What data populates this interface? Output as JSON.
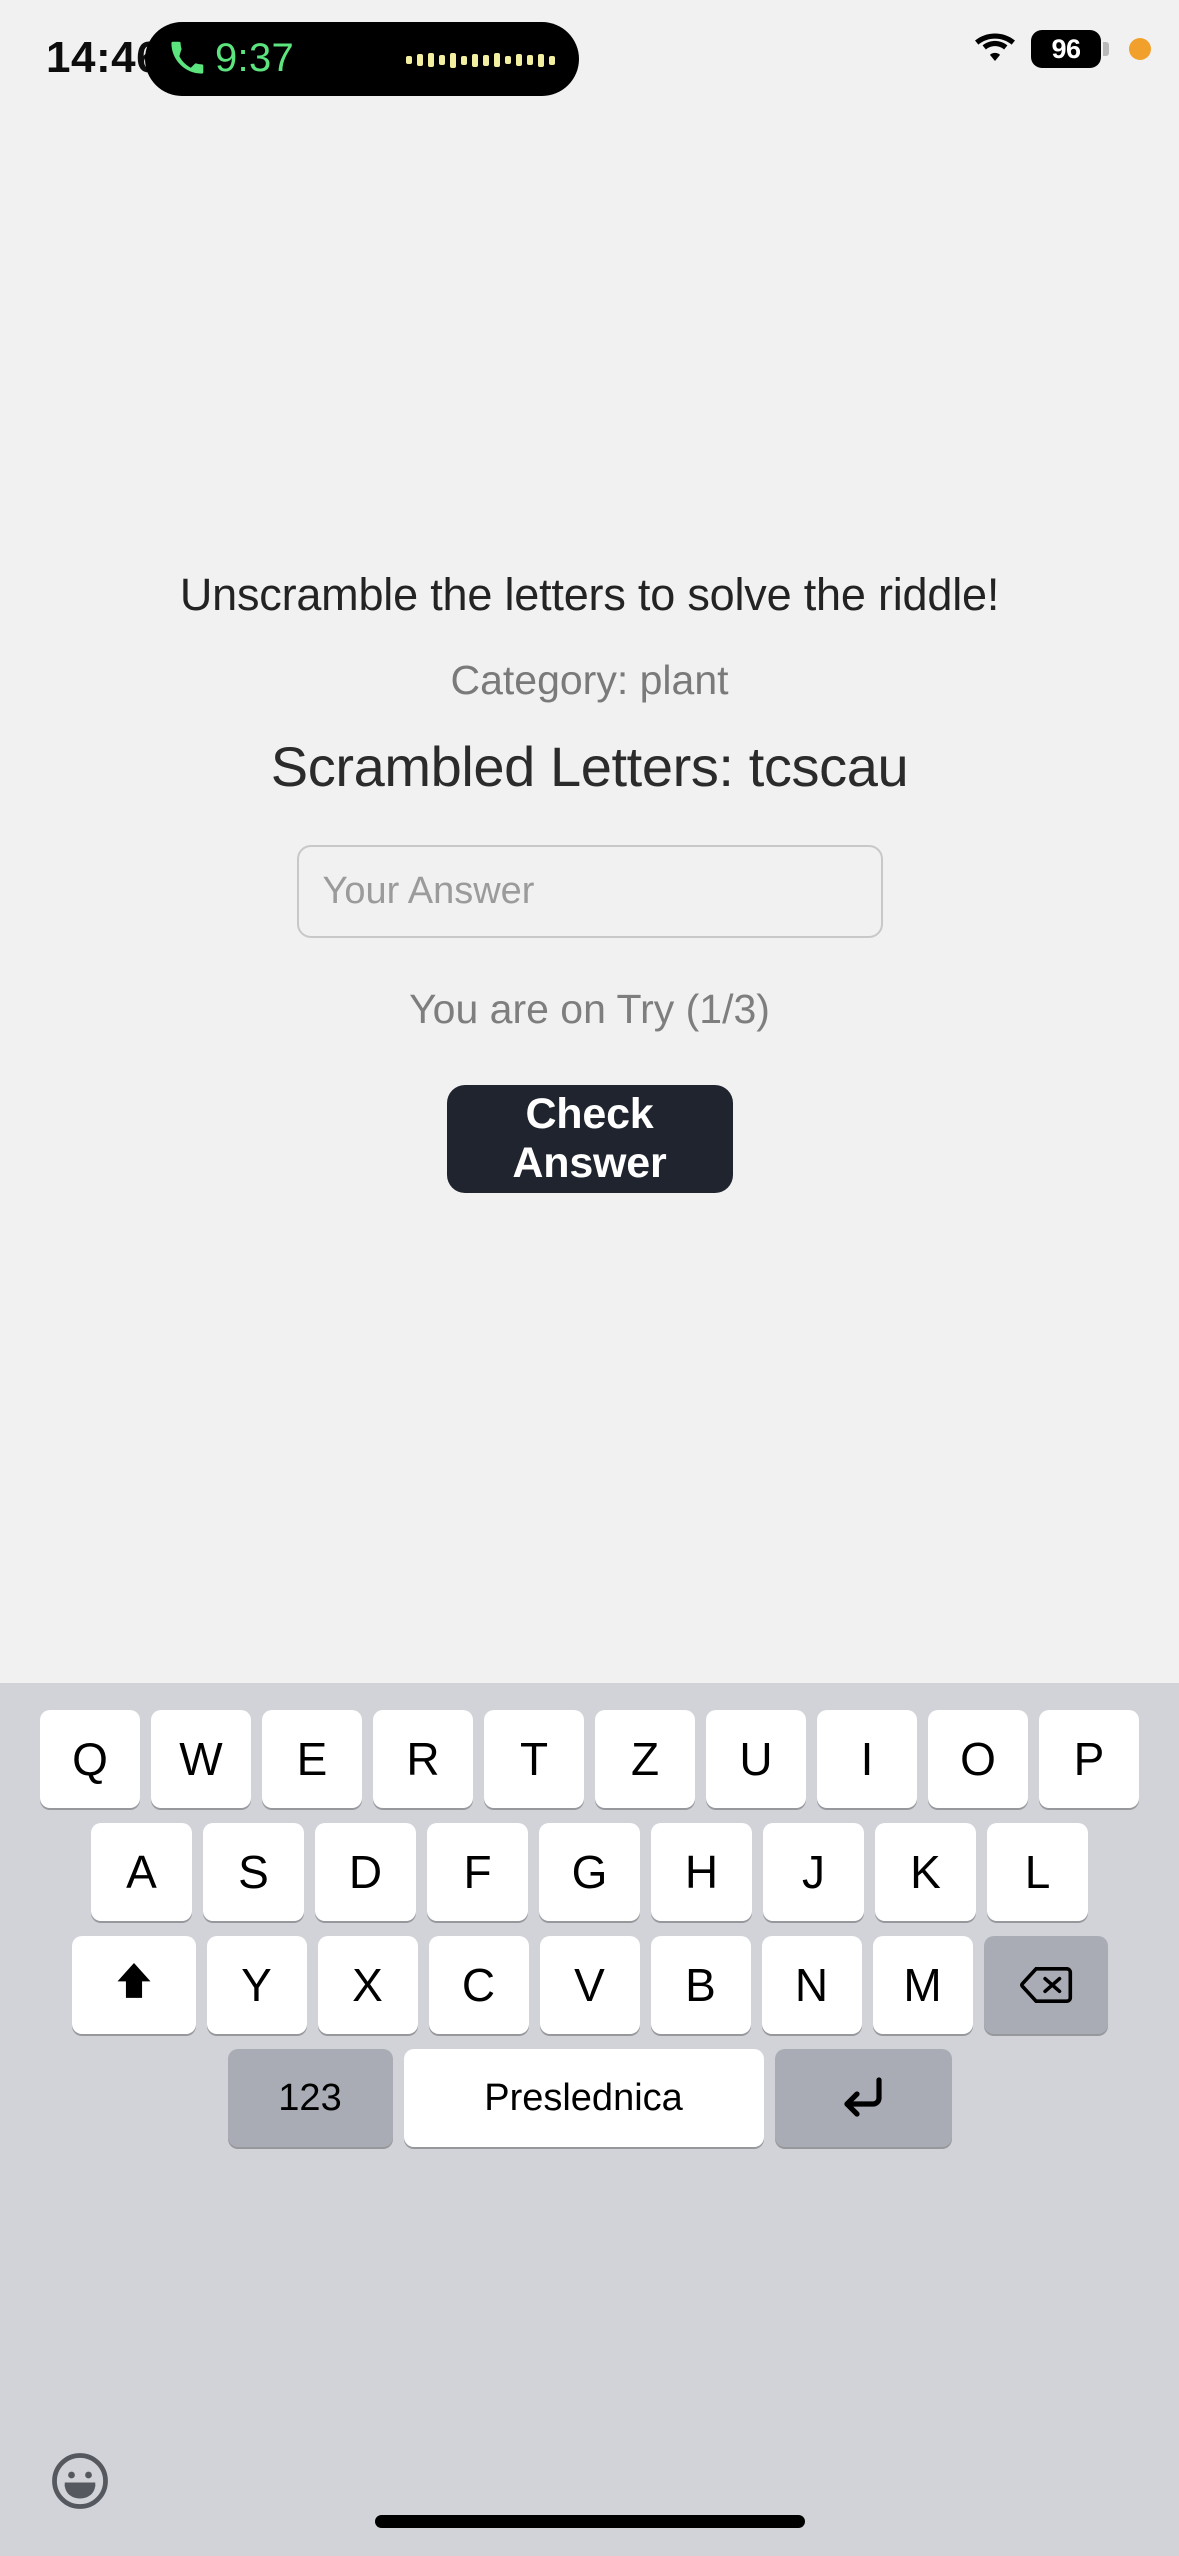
{
  "status_bar": {
    "clock": "14:46",
    "dynamic_island": {
      "call_icon": "phone-icon",
      "call_duration": "9:37",
      "waveform_bars": [
        8,
        12,
        14,
        10,
        15,
        9,
        13,
        11,
        14,
        8,
        12,
        10,
        13,
        9
      ]
    },
    "wifi_icon": "wifi-icon",
    "battery_percent": "96",
    "privacy_indicator": "orange-privacy-dot",
    "colors": {
      "island_bg": "#000000",
      "call_green": "#5ce47f",
      "waveform": "#f2f0a0",
      "privacy_orange": "#f1a12b"
    }
  },
  "game": {
    "prompt": "Unscramble the letters to solve the riddle!",
    "category_label": "Category: plant",
    "scrambled_label": "Scrambled Letters: tcscau",
    "answer_input": {
      "value": "",
      "placeholder": "Your Answer"
    },
    "try_status": "You are on Try (1/3)",
    "check_button": "Check Answer",
    "colors": {
      "page_bg": "#f1f1f1",
      "button_bg": "#20242e",
      "button_text": "#ffffff",
      "muted_text": "#7a7a7a"
    }
  },
  "keyboard": {
    "layout": "QWERTZ",
    "row1": [
      "Q",
      "W",
      "E",
      "R",
      "T",
      "Z",
      "U",
      "I",
      "O",
      "P"
    ],
    "row2": [
      "A",
      "S",
      "D",
      "F",
      "G",
      "H",
      "J",
      "K",
      "L"
    ],
    "row3": [
      "Y",
      "X",
      "C",
      "V",
      "B",
      "N",
      "M"
    ],
    "shift_icon": "shift-arrow-up-icon",
    "backspace_icon": "backspace-delete-icon",
    "numeric_label": "123",
    "space_label": "Preslednica",
    "return_icon": "return-enter-icon",
    "emoji_icon": "emoji-smiley-icon",
    "colors": {
      "keyboard_bg": "#d1d3d9",
      "key_bg": "#ffffff",
      "modifier_bg": "#a9acb4"
    }
  },
  "home_indicator": "home-indicator-bar"
}
